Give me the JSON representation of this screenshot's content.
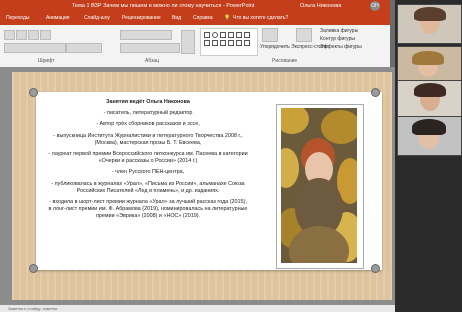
{
  "window": {
    "title": "Тема 1 ВЗР Зачем мы пишем и можно ли этому научиться  -  PowerPoint",
    "user_name": "Ольга Никонова",
    "user_initials": "ОН"
  },
  "ribbon": {
    "tabs": [
      "Переходы",
      "Анимация",
      "Слайд-шоу",
      "Рецензирование",
      "Вид",
      "Справка"
    ],
    "tell_me": "Что вы хотите сделать?",
    "group_labels": [
      "Шрифт",
      "Абзац",
      "Рисование"
    ],
    "buttons": {
      "arrange": "Упорядочить",
      "quick_styles": "Экспресс-стили",
      "shape_fill": "Заливка фигуры",
      "shape_outline": "Контур фигуры",
      "shape_effects": "Эффекты фигуры"
    }
  },
  "slide": {
    "heading": "Занятия ведёт Ольга Никонова",
    "paragraphs": [
      "- писатель, литературный редактор",
      "- Автор трёх сборников рассказов и эссе,",
      "- выпускница Института Журналистики и литературного Творчества 2008 г., (Москва), мастерская прозы Б. Т. Евсеева,",
      "- лауреат первой премии Всероссийского литконкурса им. Пасеева в категории «Очерки и рассказы о России» (2014 г.)",
      "- член Русского ПЕН-центра,",
      "- публиковалась в журналах «Урал», «Письма из России», альманахе Союза Российских Писателей «Лед и пламень», и др. изданиях.",
      "- входила в шорт-лист премии журнала «Урал» за лучший рассказ года (2015), в лонг-лист премии им. Ф. Абрамова (2019), номинировалась на литературные премии «Эврика» (2008) и «НОС» (2019)."
    ]
  },
  "status_bar": {
    "text": "Заметки к слайду: заметки"
  },
  "colors": {
    "accent": "#c43e1c",
    "slide_background": "#e4c9a3"
  }
}
